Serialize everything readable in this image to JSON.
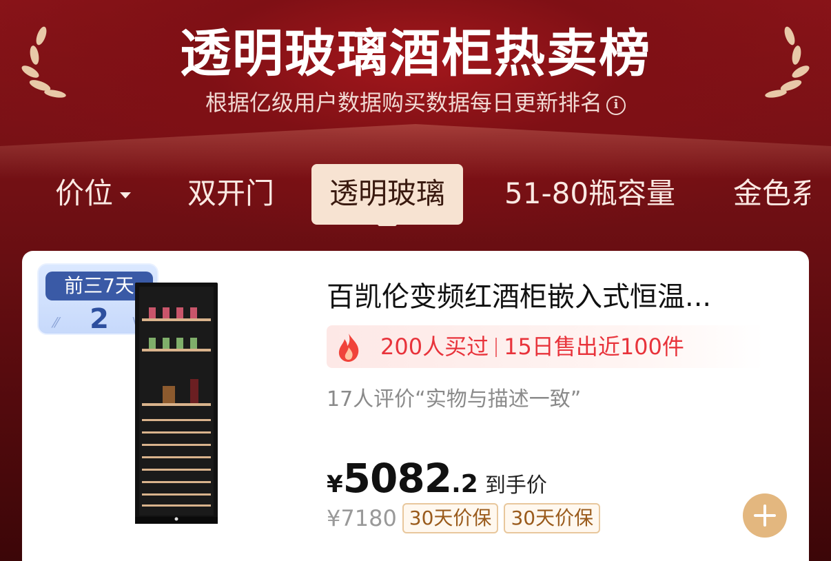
{
  "header": {
    "title": "透明玻璃酒柜热卖榜",
    "subtitle": "根据亿级用户数据购买数据每日更新排名",
    "info_icon": "info-icon"
  },
  "tabs": [
    {
      "label": "价位",
      "has_dropdown": true
    },
    {
      "label": "双开门"
    },
    {
      "label": "透明玻璃",
      "active": true
    },
    {
      "label": "51-80瓶容量"
    },
    {
      "label": "金色系"
    }
  ],
  "product": {
    "badge": {
      "label": "前三7天",
      "rank": "2"
    },
    "title": "百凯伦变频红酒柜嵌入式恒温...",
    "sales": {
      "bought": "200人买过",
      "sold": "15日售出近100件"
    },
    "review": "17人评价“实物与描述一致”",
    "price": {
      "symbol": "¥",
      "integer": "5082",
      "decimal": ".2",
      "label": "到手价"
    },
    "original_price": "¥7180",
    "tags": [
      "30天价保",
      "30天价保"
    ],
    "add_button_icon": "plus-icon"
  },
  "colors": {
    "header_bg": "#8a1419",
    "accent_red": "#e8333b",
    "tag_border": "#e8c79c",
    "add_button": "#e3b77f",
    "badge_blue": "#3a5aa6"
  }
}
